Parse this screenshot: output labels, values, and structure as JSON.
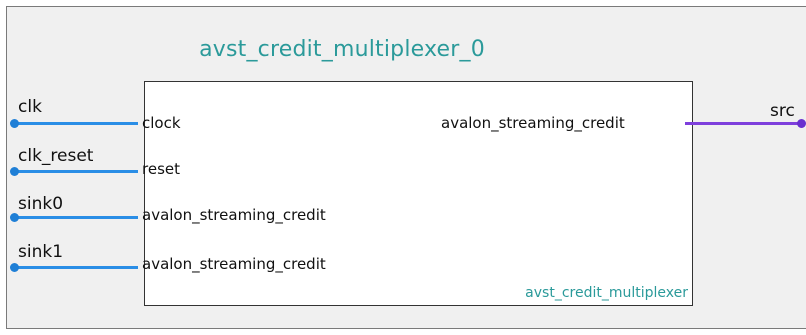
{
  "instance_name": "avst_credit_multiplexer_0",
  "component_type": "avst_credit_multiplexer",
  "ports": [
    {
      "external": "clk",
      "internal": "clock"
    },
    {
      "external": "clk_reset",
      "internal": "reset"
    },
    {
      "external": "sink0",
      "internal": "avalon_streaming_credit"
    },
    {
      "external": "sink1",
      "internal": "avalon_streaming_credit"
    }
  ],
  "output_port": {
    "external": "src",
    "internal": "avalon_streaming_credit"
  },
  "colors": {
    "title": "#2b9a9a",
    "wire_in": "#2a8ee6",
    "wire_out": "#7e3fdc",
    "background": "#f0f0f0"
  }
}
